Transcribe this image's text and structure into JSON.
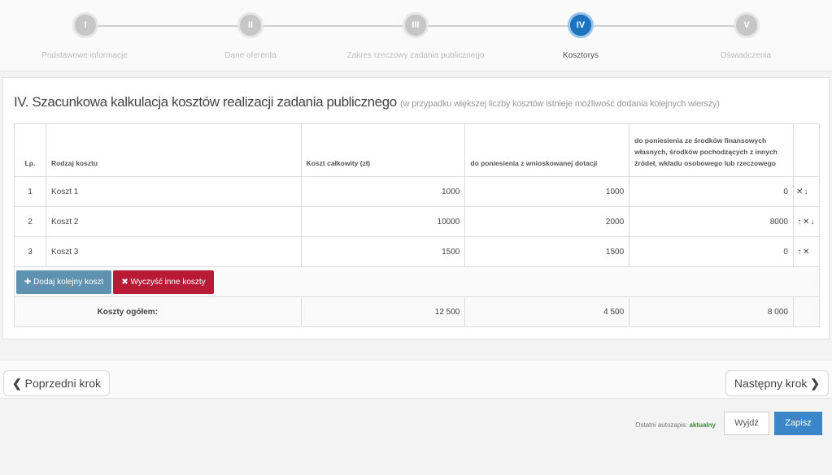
{
  "stepper": {
    "steps": [
      {
        "numeral": "I",
        "label": "Podstawowe informacje"
      },
      {
        "numeral": "II",
        "label": "Dane oferenta"
      },
      {
        "numeral": "III",
        "label": "Zakres rzeczowy zadania publicznego"
      },
      {
        "numeral": "IV",
        "label": "Kosztorys"
      },
      {
        "numeral": "V",
        "label": "Oświadczenia"
      }
    ],
    "active_index": 3
  },
  "panel": {
    "title": "IV. Szacunkowa kalkulacja kosztów realizacji zadania publicznego",
    "subtitle": "(w przypadku większej liczby kosztów istnieje możliwość dodania kolejnych wierszy)"
  },
  "table": {
    "headers": {
      "lp": "Lp.",
      "name": "Rodzaj kosztu",
      "total": "Koszt całkowity (zł)",
      "grant": "do poniesienia z wnioskowanej dotacji",
      "own": "do poniesienia ze środków finansowych własnych, środków pochodzących z innych źródeł, wkładu osobowego lub rzeczowego"
    },
    "rows": [
      {
        "lp": "1",
        "name": "Koszt 1",
        "total": "1000",
        "grant": "1000",
        "own": "0"
      },
      {
        "lp": "2",
        "name": "Koszt 2",
        "total": "10000",
        "grant": "2000",
        "own": "8000"
      },
      {
        "lp": "3",
        "name": "Koszt 3",
        "total": "1500",
        "grant": "1500",
        "own": "0"
      }
    ],
    "add_label": "Dodaj kolejny koszt",
    "clear_label": "Wyczyść inne koszty",
    "sum_label": "Koszty ogółem:",
    "sum_total": "12 500",
    "sum_grant": "4 500",
    "sum_own": "8 000"
  },
  "nav": {
    "prev_label": "Poprzedni krok",
    "next_label": "Następny krok"
  },
  "footer": {
    "autosave_label": "Ostatni autozapis:",
    "autosave_status": "aktualny",
    "exit_label": "Wyjdź",
    "save_label": "Zapisz"
  },
  "colors": {
    "active_step": "#1e73be",
    "add_button": "#5f92b0",
    "clear_button": "#b81a35",
    "save_button": "#3a86c8",
    "autosave_ok": "#3b8a3b"
  },
  "icons": {
    "add": "plus-icon",
    "clear": "x-icon",
    "prev": "chevron-left-icon",
    "next": "chevron-right-icon",
    "row_move_up": "arrow-up-icon",
    "row_move_down": "arrow-down-icon",
    "row_delete": "x-icon"
  }
}
